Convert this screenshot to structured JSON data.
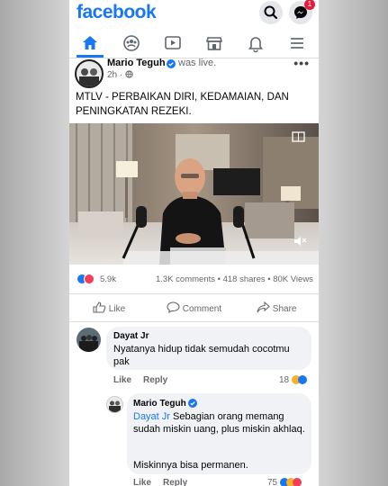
{
  "app": {
    "brand": "facebook",
    "messenger_badge": "1"
  },
  "post": {
    "author": "Mario Teguh",
    "status": "was live.",
    "time": "2h",
    "text": "MTLV - PERBAIKAN DIRI, KEDAMAIAN, DAN PENINGKATAN REZEKI.",
    "reactions_count": "5.9k",
    "stats": "1.3K comments • 418 shares • 80K Views",
    "actions": {
      "like": "Like",
      "comment": "Comment",
      "share": "Share"
    }
  },
  "comments": [
    {
      "author": "Dayat Jr",
      "text": "Nyatanya hidup tidak semudah cocotmu pak",
      "like": "Like",
      "reply": "Reply",
      "reaction_count": "18"
    },
    {
      "author": "Mario Teguh",
      "mention": "Dayat Jr",
      "text_after_mention": " Sebagian orang memang sudah miskin uang, plus miskin akhlaq.",
      "text_second": "Miskinnya bisa permanen.",
      "like": "Like",
      "reply": "Reply",
      "reaction_count": "75"
    }
  ],
  "colors": {
    "accent": "#1877f2",
    "verified": "#1877f2",
    "like_blue": "#1877f2",
    "love_red": "#f33e58",
    "haha_yellow": "#f7b125"
  }
}
